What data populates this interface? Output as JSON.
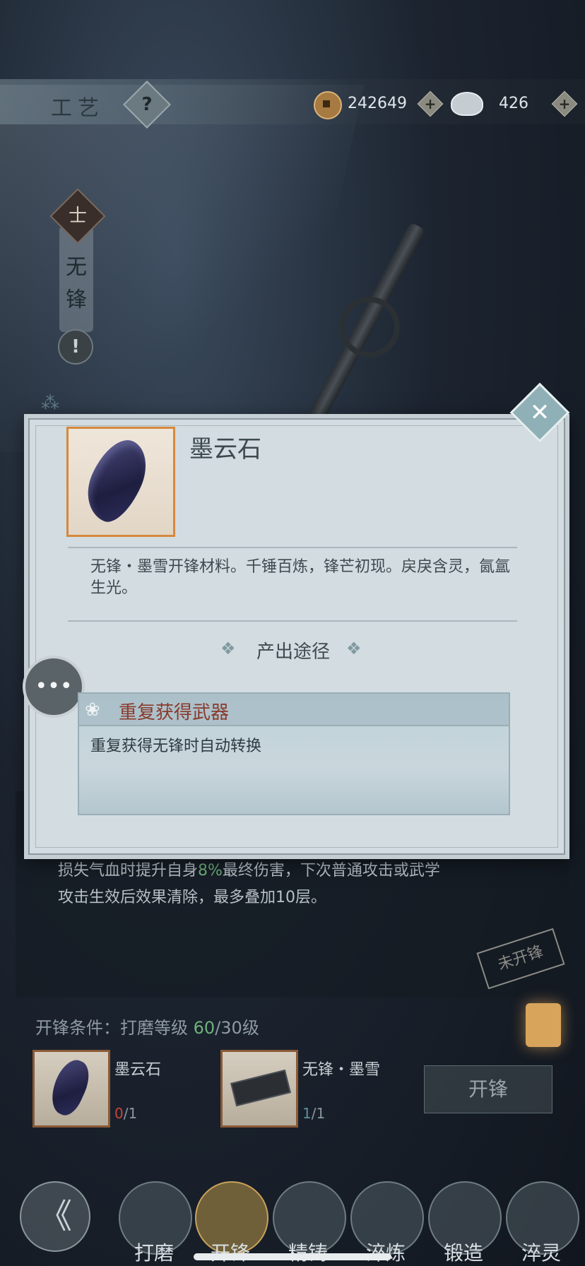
{
  "header": {
    "title": "工艺",
    "help_glyph": "?",
    "copper_amount": "242649",
    "silver_amount": "426",
    "plus_glyph": "+",
    "icons": [
      "coin-icon",
      "silver-ingot-icon",
      "help-icon",
      "plus-icon"
    ]
  },
  "weapon_badge": {
    "rank_glyph": "士",
    "name": "无锋",
    "alert_glyph": "!"
  },
  "dialog": {
    "item_name": "墨云石",
    "item_description": "无锋・墨雪开锋材料。千锤百炼，锋芒初现。戻戾含灵，氤氲生光。",
    "source_heading": "产出途径",
    "deco_glyph": "❖",
    "close_glyph": "✕",
    "chat_glyph": "•••",
    "birds_glyph": "⁂",
    "source": {
      "title": "重复获得武器",
      "description": "重复获得无锋时自动转换",
      "icon": "lotus-icon"
    }
  },
  "background": {
    "effect_text_1": "损失气血时提升自身",
    "effect_pct": "8%",
    "effect_text_2": "最终伤害，下次普通攻击或武学",
    "effect_text_3": "攻击生效后效果清除，最多叠加10层。",
    "stamp": "未开锋",
    "condition_label": "开锋条件：打磨等级 ",
    "condition_current": "60",
    "condition_required": "/30级",
    "materials": [
      {
        "name": "墨云石",
        "have": "0",
        "need": "/1"
      },
      {
        "name": "无锋・墨雪",
        "have": "1",
        "need": "/1"
      }
    ],
    "kaifeng_button": "开锋"
  },
  "nav": {
    "back_glyph": "《",
    "tabs": [
      "打磨",
      "开锋",
      "精铸",
      "淬炼",
      "锻造",
      "淬灵"
    ],
    "active_tab": "开锋"
  },
  "colors": {
    "accent_green": "#6fb07a",
    "accent_red": "#c8443c",
    "frame_orange": "#d5893e",
    "source_title": "#8a3a2c"
  }
}
